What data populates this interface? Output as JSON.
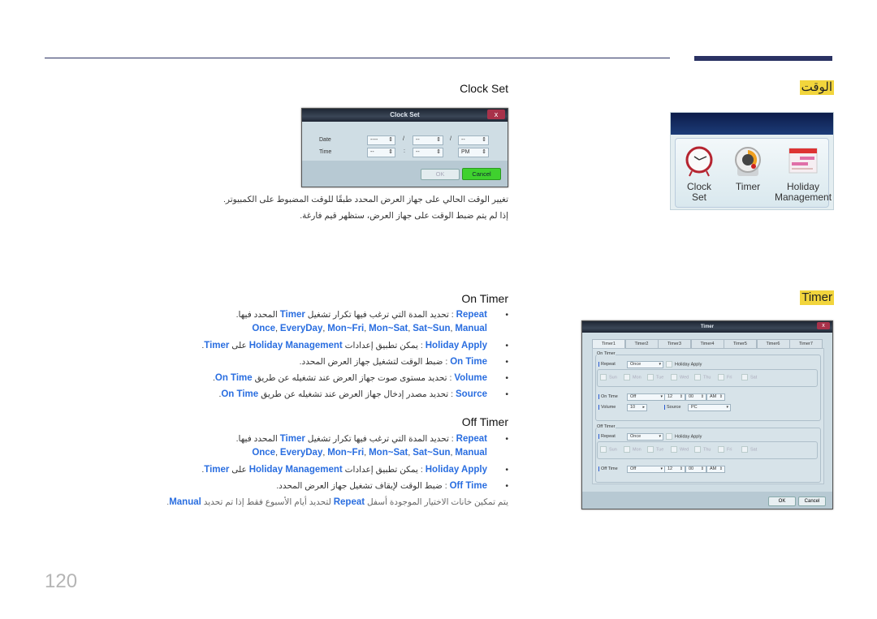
{
  "page_number": "120",
  "clock": {
    "section_label": "الوقت",
    "heading": "Clock Set",
    "dialog": {
      "title": "Clock Set",
      "close": "x",
      "date_label": "Date",
      "time_label": "Time",
      "date_values": [
        "----",
        "--",
        "--"
      ],
      "date_sep": "/",
      "time_sep": ":",
      "time_values": [
        "--",
        "--",
        "PM"
      ],
      "ok": "OK",
      "cancel": "Cancel"
    },
    "lines": [
      "تغيير الوقت الحالي على جهاز العرض المحدد طبقًا للوقت المضبوط على الكمبيوتر.",
      "إذا لم يتم ضبط الوقت على جهاز العرض، ستظهر قيم فارغة."
    ]
  },
  "menu_panel": {
    "items": [
      {
        "label1": "Clock",
        "label2": "Set",
        "icon": "alarm-clock-icon"
      },
      {
        "label1": "Timer",
        "label2": "",
        "icon": "timer-icon"
      },
      {
        "label1": "Holiday",
        "label2": "Management",
        "icon": "calendar-icon"
      }
    ]
  },
  "timer": {
    "section_label": "Timer",
    "on_heading": "On Timer",
    "off_heading": "Off Timer",
    "on_bullets": [
      {
        "term": "Repeat",
        "sep": " : ",
        "desc": [
          {
            "t": "تحديد المدة التي ترغب فيها تكرار تشغيل "
          },
          {
            "t": "Timer",
            "b": 1
          },
          {
            "t": " المحدد فيها."
          }
        ]
      },
      {
        "term": "Holiday Apply",
        "sep": " : ",
        "desc": [
          {
            "t": "يمكن تطبيق إعدادات "
          },
          {
            "t": "Holiday Management",
            "b": 1
          },
          {
            "t": " على "
          },
          {
            "t": "Timer",
            "b": 1
          },
          {
            "t": "."
          }
        ]
      },
      {
        "term": "On Time",
        "sep": " : ",
        "desc": [
          {
            "t": "ضبط الوقت لتشغيل جهاز العرض المحدد."
          }
        ]
      },
      {
        "term": "Volume",
        "sep": " : ",
        "desc": [
          {
            "t": "تحديد مستوى صوت جهاز العرض عند تشغيله عن طريق "
          },
          {
            "t": "On Time",
            "b": 1
          },
          {
            "t": "."
          }
        ]
      },
      {
        "term": "Source",
        "sep": " : ",
        "desc": [
          {
            "t": "تحديد مصدر إدخال جهاز العرض عند تشغيله عن طريق "
          },
          {
            "t": "On Time",
            "b": 1
          },
          {
            "t": "."
          }
        ]
      }
    ],
    "repeat_options": [
      "Once",
      "EveryDay",
      "Mon~Fri",
      "Mon~Sat",
      "Sat~Sun",
      "Manual"
    ],
    "off_bullets": [
      {
        "term": "Repeat",
        "sep": " : ",
        "desc": [
          {
            "t": "تحديد المدة التي ترغب فيها تكرار تشغيل "
          },
          {
            "t": "Timer",
            "b": 1
          },
          {
            "t": " المحدد فيها."
          }
        ]
      },
      {
        "term": "Holiday Apply",
        "sep": " : ",
        "desc": [
          {
            "t": "يمكن تطبيق إعدادات "
          },
          {
            "t": "Holiday Management",
            "b": 1
          },
          {
            "t": " على "
          },
          {
            "t": "Timer",
            "b": 1
          },
          {
            "t": "."
          }
        ]
      },
      {
        "term": "Off Time",
        "sep": " : ",
        "desc": [
          {
            "t": "ضبط الوقت لإيقاف تشغيل جهاز العرض المحدد."
          }
        ]
      }
    ],
    "note": [
      {
        "t": "يتم تمكين خانات الاختيار الموجودة أسفل "
      },
      {
        "t": "Repeat",
        "b": 1
      },
      {
        "t": " لتحديد أيام الأسبوع فقط إذا تم تحديد "
      },
      {
        "t": "Manual",
        "b": 1
      },
      {
        "t": "."
      }
    ],
    "dialog": {
      "title": "Timer",
      "close": "x",
      "tabs": [
        "Timer1",
        "Timer2",
        "Timer3",
        "Timer4",
        "Timer5",
        "Timer6",
        "Timer7"
      ],
      "on_group": "On Timer",
      "off_group": "Off Timer",
      "repeat_label": "Repeat",
      "repeat_value": "Once",
      "holiday_apply": "Holiday Apply",
      "days": [
        "Sun",
        "Mon",
        "Tue",
        "Wed",
        "Thu",
        "Fri",
        "Sat"
      ],
      "on_time_label": "On Time",
      "off_time_label": "Off Time",
      "time_value": "Off",
      "hour": "12",
      "minute": "00",
      "ampm": "AM",
      "volume_label": "Volume",
      "volume_value": "10",
      "source_label": "Source",
      "source_value": "PC",
      "ok": "OK",
      "cancel": "Cancel"
    }
  }
}
